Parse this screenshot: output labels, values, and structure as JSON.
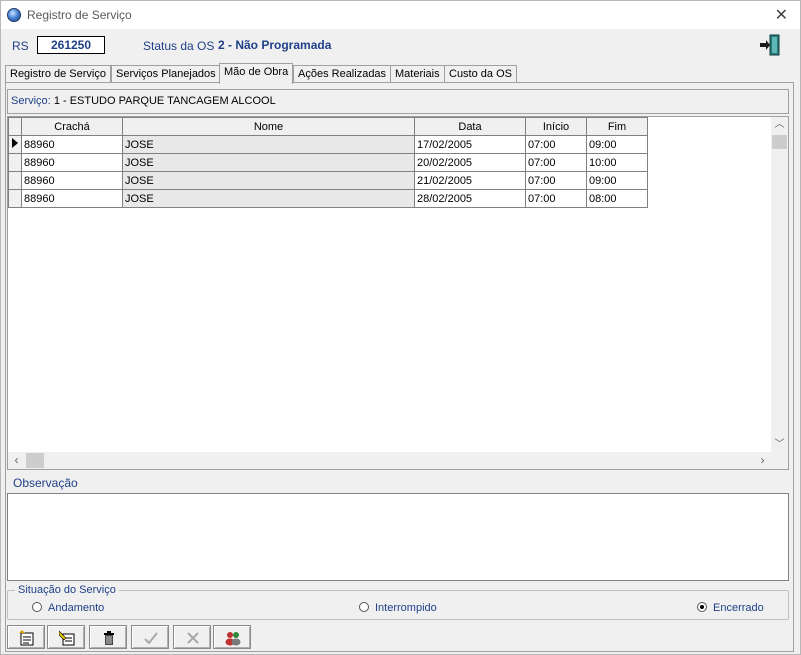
{
  "window": {
    "title": "Registro de Serviço"
  },
  "header": {
    "rs_label": "RS",
    "rs_value": "261250",
    "status_label": "Status da OS",
    "status_value": "2 - Não Programada"
  },
  "tabs": [
    {
      "label": "Registro de Serviço",
      "active": false
    },
    {
      "label": "Serviços Planejados",
      "active": false
    },
    {
      "label": "Mão de Obra",
      "active": true
    },
    {
      "label": "Ações Realizadas",
      "active": false
    },
    {
      "label": "Materiais",
      "active": false
    },
    {
      "label": "Custo da OS",
      "active": false
    }
  ],
  "service": {
    "label": "Serviço:",
    "value": "1 - ESTUDO PARQUE TANCAGEM ALCOOL"
  },
  "grid": {
    "columns": [
      "Crachá",
      "Nome",
      "Data",
      "Início",
      "Fim"
    ],
    "rows": [
      {
        "cracha": "88960",
        "nome": "JOSE",
        "data": "17/02/2005",
        "inicio": "07:00",
        "fim": "09:00"
      },
      {
        "cracha": "88960",
        "nome": "JOSE",
        "data": "20/02/2005",
        "inicio": "07:00",
        "fim": "10:00"
      },
      {
        "cracha": "88960",
        "nome": "JOSE",
        "data": "21/02/2005",
        "inicio": "07:00",
        "fim": "09:00"
      },
      {
        "cracha": "88960",
        "nome": "JOSE",
        "data": "28/02/2005",
        "inicio": "07:00",
        "fim": "08:00"
      }
    ]
  },
  "observation": {
    "label": "Observação",
    "value": ""
  },
  "situation": {
    "label": "Situação do Serviço",
    "options": [
      {
        "label": "Andamento",
        "checked": false
      },
      {
        "label": "Interrompido",
        "checked": false
      },
      {
        "label": "Encerrado",
        "checked": true
      }
    ]
  },
  "toolbar": {
    "buttons": [
      {
        "icon": "new-record-icon",
        "enabled": true
      },
      {
        "icon": "edit-record-icon",
        "enabled": true
      },
      {
        "icon": "trash-icon",
        "enabled": true
      },
      {
        "icon": "check-icon",
        "enabled": false
      },
      {
        "icon": "cancel-x-icon",
        "enabled": false
      },
      {
        "icon": "people-icon",
        "enabled": true
      }
    ]
  },
  "colors": {
    "label_blue": "#1f3f88",
    "background": "#f0f0f0"
  }
}
